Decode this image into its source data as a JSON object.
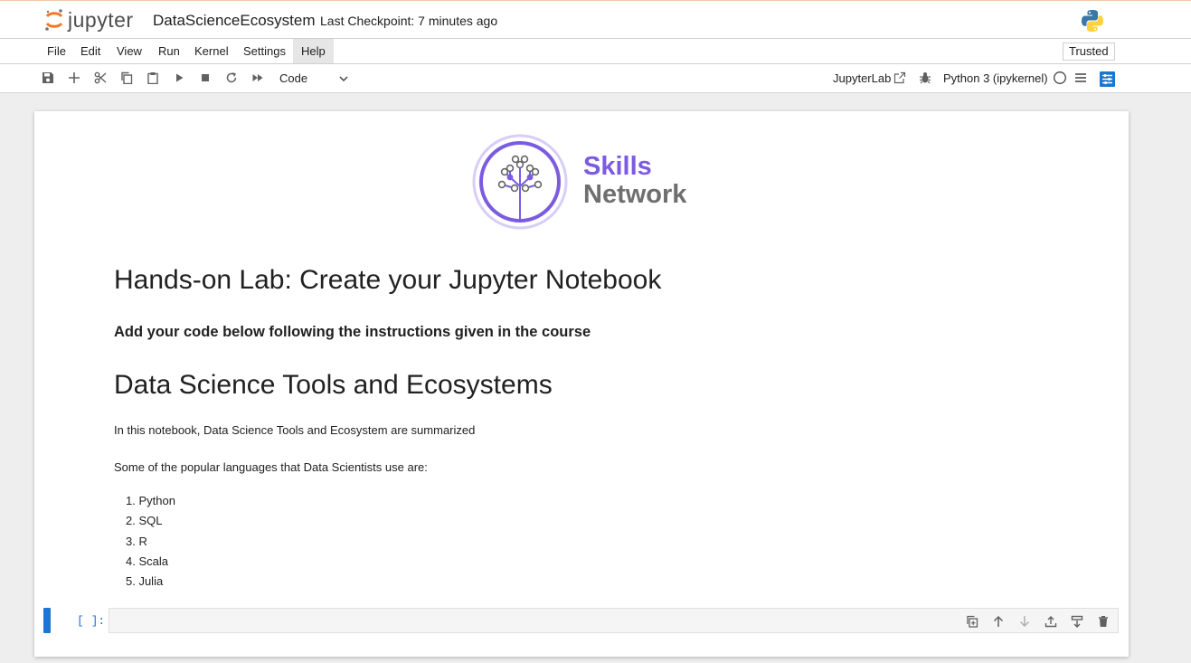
{
  "header": {
    "app_name": "jupyter",
    "notebook_title": "DataScienceEcosystem",
    "checkpoint": "Last Checkpoint: 7 minutes ago",
    "kernel_logo": "python-logo-icon"
  },
  "menu": {
    "items": [
      "File",
      "Edit",
      "View",
      "Run",
      "Kernel",
      "Settings",
      "Help"
    ],
    "active": "Help",
    "trusted_label": "Trusted"
  },
  "toolbar": {
    "buttons": [
      "save-icon",
      "plus-icon",
      "cut-icon",
      "copy-icon",
      "paste-icon",
      "run-icon",
      "stop-icon",
      "restart-icon",
      "fast-forward-icon"
    ],
    "cell_type": "Code",
    "jupyterlab_label": "JupyterLab",
    "kernel_name": "Python 3 (ipykernel)"
  },
  "notebook": {
    "logo": {
      "skills": "Skills",
      "network": "Network"
    },
    "heading1": "Hands-on Lab: Create your Jupyter Notebook",
    "subheading": "Add your code below following the instructions given in the course",
    "heading2": "Data Science Tools and Ecosystems",
    "intro": "In this notebook, Data Science Tools and Ecosystem are summarized",
    "languages_intro": "Some of the popular languages that Data Scientists use are:",
    "languages": [
      "1. Python",
      "2. SQL",
      "3. R",
      "4. Scala",
      "5. Julia"
    ],
    "code_cell": {
      "prompt": "[ ]:",
      "value": ""
    },
    "cell_toolbar": [
      "duplicate-icon",
      "move-up-icon",
      "move-down-icon",
      "insert-above-icon",
      "insert-below-icon",
      "delete-icon"
    ]
  },
  "colors": {
    "brand_orange": "#f37726",
    "active_cell": "#1976d2",
    "skills_purple": "#7b5be0"
  }
}
